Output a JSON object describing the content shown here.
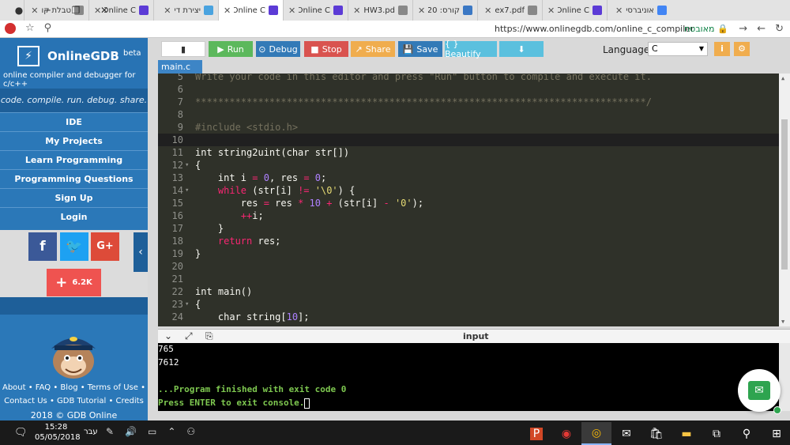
{
  "browser": {
    "tabs": [
      {
        "title": "אוניברסי",
        "color": "#4285f4"
      },
      {
        "title": "Online C",
        "color": "#5c3bd6"
      },
      {
        "title": "ex7.pdf",
        "color": "#888888"
      },
      {
        "title": "קורס: 20",
        "color": "#3b78c4"
      },
      {
        "title": "HW3.pd",
        "color": "#888888"
      },
      {
        "title": "Online C",
        "color": "#5c3bd6"
      },
      {
        "title": "Online C",
        "color": "#5c3bd6"
      },
      {
        "title": "יצירת די",
        "color": "#4aa3df"
      },
      {
        "title": "Online C",
        "color": "#5c3bd6"
      },
      {
        "title": "טבלת קו",
        "color": "#888888"
      }
    ],
    "url": "https://www.onlinegdb.com/online_c_compiler",
    "secure_label": "מאובטח"
  },
  "sidebar": {
    "brand": "OnlineGDB",
    "brand_sup": "beta",
    "subtitle": "online compiler and debugger for c/c++",
    "tagline": "code. compile. run. debug. share.",
    "nav": [
      "IDE",
      "My Projects",
      "Learn Programming",
      "Programming Questions",
      "Sign Up",
      "Login"
    ],
    "share_count": "6.2K",
    "footer_line1": "About • FAQ • Blog • Terms of Use •",
    "footer_line2": "Contact Us • GDB Tutorial • Credits",
    "copyright": "2018 © GDB Online"
  },
  "toolbar": {
    "run": "Run",
    "debug": "Debug",
    "stop": "Stop",
    "share": "Share",
    "save": "Save",
    "beautify": "{ } Beautify",
    "language_label": "Language",
    "language_value": "C",
    "colors": {
      "run": "#5cb85c",
      "debug": "#337ab7",
      "stop": "#d9534f",
      "share": "#f0ad4e",
      "save": "#337ab7",
      "beautify": "#5bc0de",
      "download": "#5bc0de"
    }
  },
  "editor": {
    "filename": "main.c",
    "lines": [
      {
        "n": "5",
        "fold": "",
        "html": "<span class=\"cm\">Write your code in this editor and press \"Run\" button to compile and execute it.</span>"
      },
      {
        "n": "6",
        "fold": "",
        "html": ""
      },
      {
        "n": "7",
        "fold": "",
        "html": "<span class=\"cm\">*******************************************************************************/</span>"
      },
      {
        "n": "8",
        "fold": "",
        "html": ""
      },
      {
        "n": "9",
        "fold": "",
        "html": "<span class=\"cm\">#include</span> <span class=\"cm\">&lt;stdio.h&gt;</span>"
      },
      {
        "n": "10",
        "fold": "",
        "html": "",
        "active": true
      },
      {
        "n": "11",
        "fold": "",
        "html": "int string2uint(char str[])"
      },
      {
        "n": "12",
        "fold": "▾",
        "html": "{"
      },
      {
        "n": "13",
        "fold": "",
        "html": "    int i <span class=\"op\">=</span> <span class=\"num\">0</span>, res <span class=\"op\">=</span> <span class=\"num\">0</span>;"
      },
      {
        "n": "14",
        "fold": "▾",
        "html": "    <span class=\"kw\">while</span> (str[i] <span class=\"op\">!=</span> <span class=\"str\">'\\0'</span>) {"
      },
      {
        "n": "15",
        "fold": "",
        "html": "        res <span class=\"op\">=</span> res <span class=\"op\">*</span> <span class=\"num\">10</span> <span class=\"op\">+</span> (str[i] <span class=\"op\">-</span> <span class=\"str\">'0'</span>);"
      },
      {
        "n": "16",
        "fold": "",
        "html": "        <span class=\"op\">++</span>i;"
      },
      {
        "n": "17",
        "fold": "",
        "html": "    }"
      },
      {
        "n": "18",
        "fold": "",
        "html": "    <span class=\"kw\">return</span> res;"
      },
      {
        "n": "19",
        "fold": "",
        "html": "}"
      },
      {
        "n": "20",
        "fold": "",
        "html": ""
      },
      {
        "n": "21",
        "fold": "",
        "html": ""
      },
      {
        "n": "22",
        "fold": "",
        "html": "int main()"
      },
      {
        "n": "23",
        "fold": "▾",
        "html": "{"
      },
      {
        "n": "24",
        "fold": "",
        "html": "    char string[<span class=\"num\">10</span>];"
      }
    ]
  },
  "io": {
    "title": "input",
    "console": [
      "765",
      "7612",
      "",
      "...Program finished with exit code 0"
    ],
    "prompt": "Press ENTER to exit console."
  },
  "taskbar": {
    "time": "15:28",
    "date": "05/05/2018",
    "lang": "עבר"
  }
}
